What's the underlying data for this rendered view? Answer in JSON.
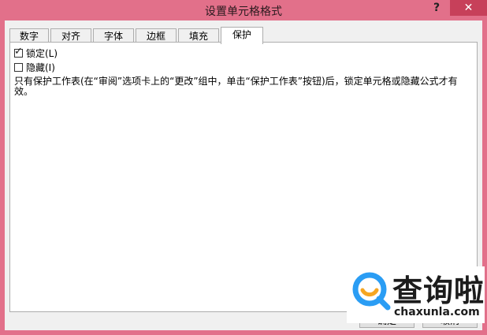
{
  "window": {
    "title": "设置单元格格式",
    "help_label": "?",
    "close_label": "✕"
  },
  "tabs": [
    {
      "label": "数字",
      "active": false
    },
    {
      "label": "对齐",
      "active": false
    },
    {
      "label": "字体",
      "active": false
    },
    {
      "label": "边框",
      "active": false
    },
    {
      "label": "填充",
      "active": false
    },
    {
      "label": "保护",
      "active": true
    }
  ],
  "protection": {
    "locked": {
      "label": "锁定(L)",
      "checked": true
    },
    "hidden": {
      "label": "隐藏(I)",
      "checked": false
    },
    "note": "只有保护工作表(在“审阅”选项卡上的“更改”组中，单击“保护工作表”按钮)后，锁定单元格或隐藏公式才有效。"
  },
  "buttons": {
    "ok_label": "确定",
    "cancel_label": "取消"
  },
  "watermark": {
    "brand": "查询啦",
    "domain": "chaxunla.com",
    "brand_color": "#2a9df4"
  }
}
